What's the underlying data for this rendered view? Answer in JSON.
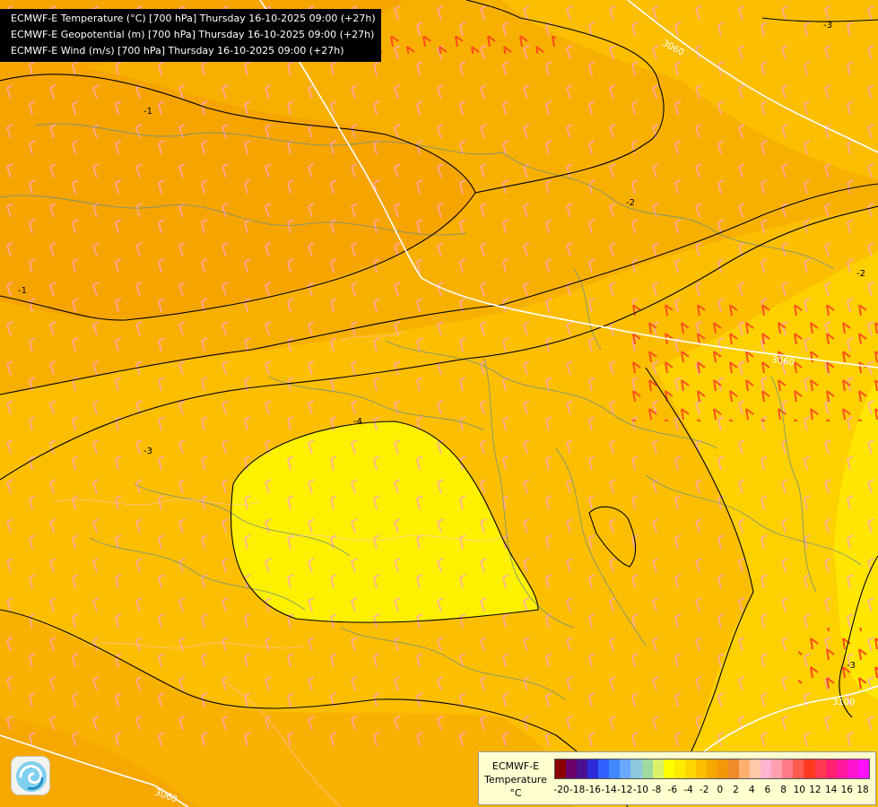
{
  "header": {
    "lines": [
      "ECMWF-E Temperature (°C) [700 hPa] Thursday 16-10-2025 09:00 (+27h)",
      "ECMWF-E Geopotential (m) [700 hPa] Thursday 16-10-2025 09:00 (+27h)",
      "ECMWF-E Wind (m/s) [700 hPa] Thursday 16-10-2025 09:00 (+27h)"
    ]
  },
  "map": {
    "temperature_isolines": [
      "-1",
      "-1",
      "-2",
      "-2",
      "-3",
      "-3",
      "-3",
      "-4"
    ],
    "geopotential_isolines": [
      "3060",
      "3060",
      "3060",
      "3100"
    ],
    "colors": {
      "field_minus1_to_0": "#f6a700",
      "field_minus2_to_minus1": "#fbbe00",
      "field_minus3_to_minus2": "#fdd500",
      "field_minus4_to_minus3": "#ffea00",
      "field_below_minus4": "#fff200",
      "temperature_isoline": "#000000",
      "geopotential_isoline": "#ffffff",
      "borders": "#6f8f8a",
      "wind_barbs": "#ff9fb0",
      "wind_barbs_strong": "#ff4a1a"
    }
  },
  "logo": {
    "icon": "ecmwf-swirl-icon"
  },
  "legend": {
    "title_lines": [
      "ECMWF-E",
      "Temperature",
      "°C"
    ],
    "ticks": [
      "-20",
      "-18",
      "-16",
      "-14",
      "-12",
      "-10",
      "-8",
      "-6",
      "-4",
      "-2",
      "0",
      "2",
      "4",
      "6",
      "8",
      "10",
      "12",
      "14",
      "16",
      "18"
    ],
    "colors": [
      "#8b0000",
      "#6a006a",
      "#4b1090",
      "#2a2ad8",
      "#3060ff",
      "#3f88ff",
      "#6aa9ff",
      "#8cc8e0",
      "#9fd9a0",
      "#d8f06a",
      "#ffff00",
      "#ffea00",
      "#ffd500",
      "#fbbe00",
      "#f6a700",
      "#f5960a",
      "#f08a2a",
      "#ffb070",
      "#ffc8a8",
      "#ffb4d0",
      "#ff9fb0",
      "#ff7a88",
      "#ff5a50",
      "#ff3a20",
      "#ff3a50",
      "#ff2070",
      "#ff1aa0",
      "#ff14d0",
      "#ff10ff"
    ]
  }
}
